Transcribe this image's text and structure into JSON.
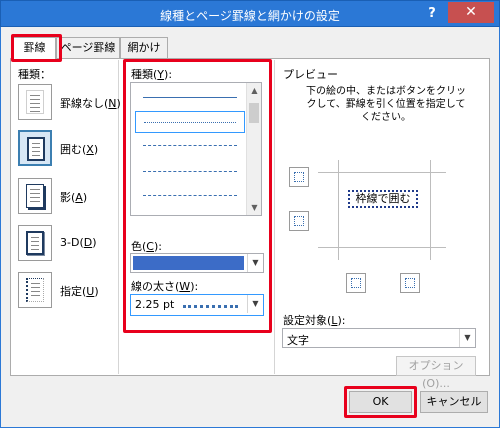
{
  "window": {
    "title": "線種とページ罫線と網かけの設定",
    "help": "?",
    "close": "✕"
  },
  "tabs": [
    {
      "label": "罫線",
      "active": true
    },
    {
      "label": "ページ罫線",
      "active": false
    },
    {
      "label": "網かけ",
      "active": false
    }
  ],
  "border_types": {
    "header": "種類：",
    "items": [
      {
        "label": "罫線なし(",
        "key": "N",
        "tail": ")",
        "selected": false
      },
      {
        "label": "囲む(",
        "key": "X",
        "tail": ")",
        "selected": true
      },
      {
        "label": "影(",
        "key": "A",
        "tail": ")",
        "selected": false
      },
      {
        "label": "3-D(",
        "key": "D",
        "tail": ")",
        "selected": false
      },
      {
        "label": "指定(",
        "key": "U",
        "tail": ")",
        "selected": false
      }
    ]
  },
  "style": {
    "header": "種類(",
    "header_key": "Y",
    "header_tail": "):",
    "color_label": "色(",
    "color_key": "C",
    "color_tail": "):",
    "color_value": "#3c6cc7",
    "width_label": "線の太さ(",
    "width_key": "W",
    "width_tail": "):",
    "width_value": "2.25 pt"
  },
  "preview": {
    "header": "プレビュー",
    "instructions": "下の絵の中、またはボタンをクリックして、罫線を引く位置を指定してください。",
    "sample_text": "枠線で囲む"
  },
  "apply_to": {
    "label": "設定対象(",
    "key": "L",
    "tail": "):",
    "value": "文字"
  },
  "buttons": {
    "options": "オプション(O)...",
    "ok": "OK",
    "cancel": "キャンセル"
  },
  "colors": {
    "title_bar": "#2b78d6",
    "highlight": "#e8001c"
  }
}
